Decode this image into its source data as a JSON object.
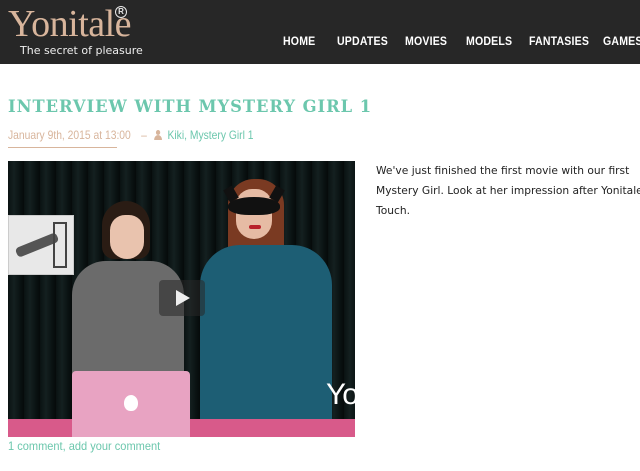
{
  "brand": {
    "name": "Yonitale",
    "registered_mark": "R",
    "tagline": "The secret of pleasure"
  },
  "nav": {
    "items": [
      {
        "label": "HOME"
      },
      {
        "label": "UPDATES"
      },
      {
        "label": "MOVIES"
      },
      {
        "label": "MODELS"
      },
      {
        "label": "FANTASIES"
      },
      {
        "label": "GAMES"
      }
    ]
  },
  "post": {
    "title": "INTERVIEW WITH MYSTERY GIRL 1",
    "date": "January 9th, 2015 at 13:00",
    "separator": "–",
    "tags": "Kiki, Mystery Girl 1",
    "body_lines": [
      "We've just finished the first movie with our first",
      "Mystery Girl. Look at her impression after Yonitale",
      "Touch."
    ],
    "video": {
      "watermark": "Yoni"
    },
    "comments": {
      "count_label": "1 comment",
      "separator": ", ",
      "add_label": "add your comment"
    }
  },
  "colors": {
    "header_bg": "#272727",
    "accent_teal": "#6cc7ad",
    "accent_tan": "#d8b59c"
  }
}
